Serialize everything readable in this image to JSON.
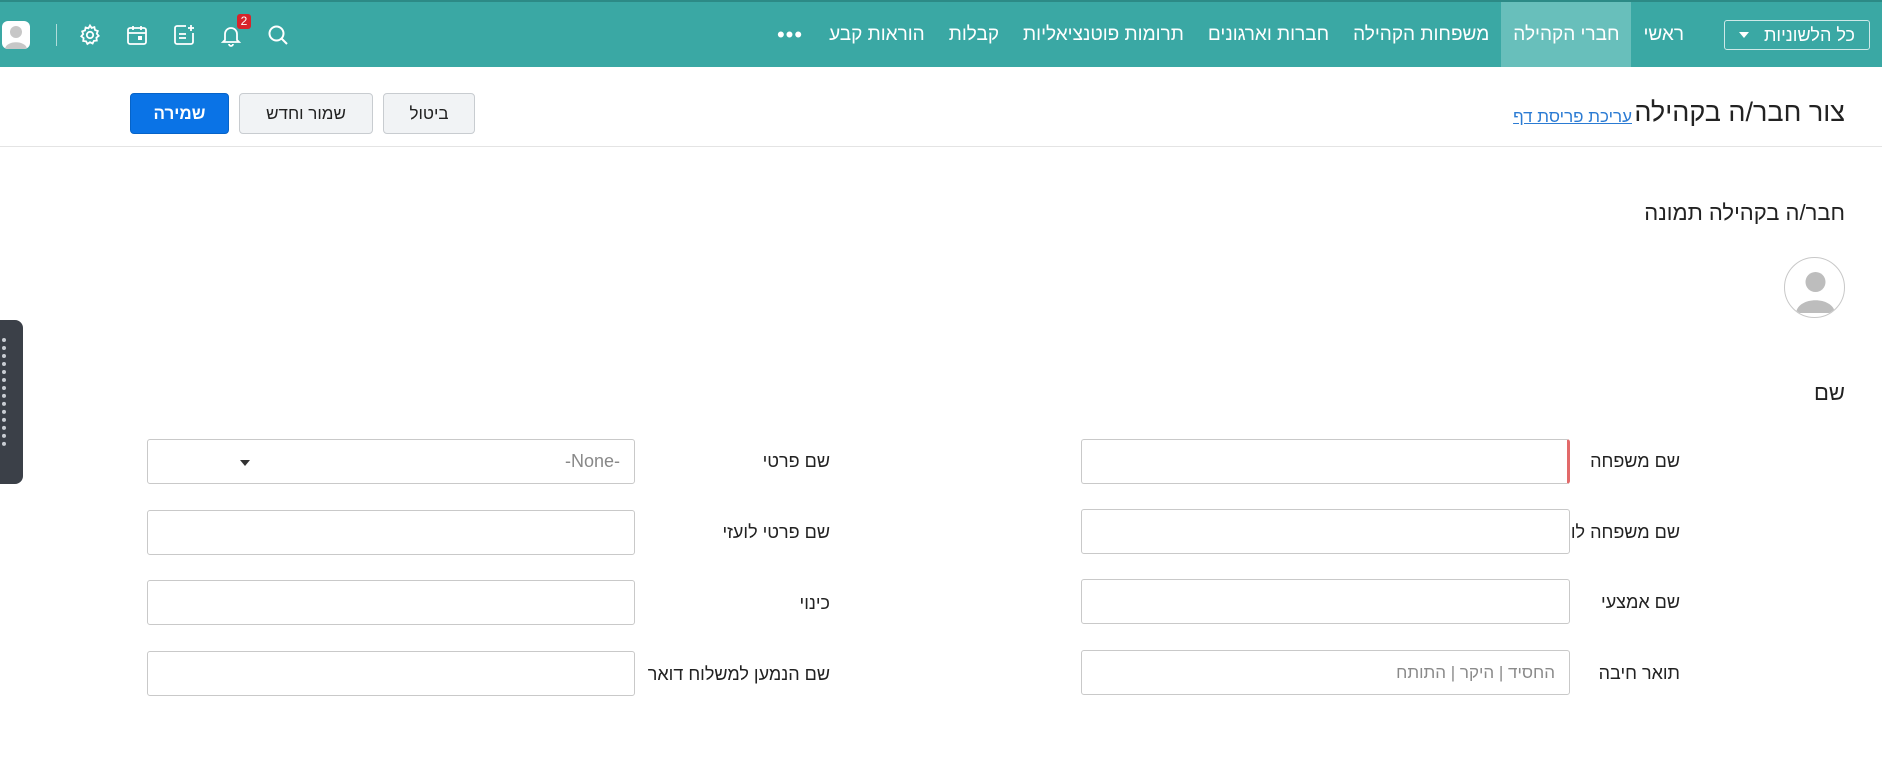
{
  "topbar": {
    "language_select": "כל הלשוניות",
    "nav": [
      {
        "label": "ראשי"
      },
      {
        "label": "חברי הקהילה"
      },
      {
        "label": "משפחות הקהילה"
      },
      {
        "label": "חברות וארגונים"
      },
      {
        "label": "תרומות פוטנציאליות"
      },
      {
        "label": "קבלות"
      },
      {
        "label": "הוראות קבע"
      }
    ],
    "more": "•••",
    "notification_count": "2",
    "icons": [
      "avatar-icon",
      "gear-icon",
      "calendar-icon",
      "add-note-icon",
      "bell-icon",
      "search-icon"
    ],
    "accent_color": "#3aa8a4",
    "active_tab_color": "#68bfbb"
  },
  "header": {
    "title": "צור חבר/ה בקהילה",
    "edit_layout_link": "עריכת פריסת דף",
    "buttons": {
      "cancel": "ביטול",
      "save_and_new": "שמור וחדש",
      "save": "שמירה"
    },
    "save_color": "#0a73e6"
  },
  "sections": {
    "photo_title": "חבר/ה בקהילה תמונה",
    "name_title": "שם"
  },
  "fields": {
    "last_name": {
      "label": "שם משפחה",
      "value": ""
    },
    "first_name": {
      "label": "שם פרטי",
      "value": "-None-"
    },
    "foreign_last_name": {
      "label": "שם משפחה לועזי",
      "value": ""
    },
    "foreign_first_name": {
      "label": "שם פרטי לועזי",
      "value": ""
    },
    "middle_name": {
      "label": "שם אמצעי",
      "value": ""
    },
    "nickname": {
      "label": "כינוי",
      "value": ""
    },
    "title": {
      "label": "תואר חיבה",
      "placeholder": "החסיד | היקר | התותח"
    },
    "mail_recipient": {
      "label": "שם הנמען למשלוח דואר",
      "value": ""
    }
  }
}
